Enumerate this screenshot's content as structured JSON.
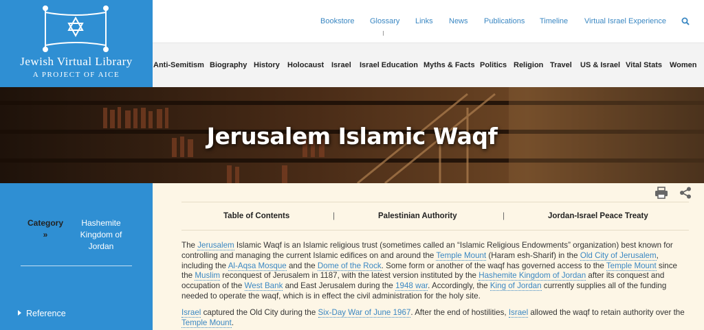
{
  "logo": {
    "line1": "Jewish Virtual Library",
    "line2": "A PROJECT OF AICE"
  },
  "topnav": [
    "Bookstore",
    "Glossary",
    "Links",
    "News",
    "Publications",
    "Timeline",
    "Virtual Israel Experience"
  ],
  "catnav": [
    "Anti-Semitism",
    "Biography",
    "History",
    "Holocaust",
    "Israel",
    "Israel Education",
    "Myths & Facts",
    "Politics",
    "Religion",
    "Travel",
    "US & Israel",
    "Vital Stats",
    "Women"
  ],
  "hero": {
    "title": "Jerusalem Islamic Waqf"
  },
  "sidebar": {
    "category_label": "Category »",
    "category_value": "Hashemite Kingdom of Jordan",
    "reference": "Reference"
  },
  "toc": {
    "items": [
      "Table of Contents",
      "Palestinian Authority",
      "Jordan-Israel Peace Treaty"
    ],
    "separator": "|"
  },
  "paragraphs": [
    [
      {
        "t": "The "
      },
      {
        "t": "Jerusalem",
        "link": true
      },
      {
        "t": " Islamic Waqf is an Islamic religious trust (sometimes called an “Islamic Religious Endowments” organization) best known for controlling and managing the current Islamic edifices on and around the "
      },
      {
        "t": "Temple Mount",
        "link": true
      },
      {
        "t": " (Haram esh-Sharif) in the "
      },
      {
        "t": "Old City of Jerusalem",
        "link": true
      },
      {
        "t": ", including the "
      },
      {
        "t": "Al-Aqsa Mosque",
        "link": true
      },
      {
        "t": " and the "
      },
      {
        "t": "Dome of the Rock",
        "link": true
      },
      {
        "t": ". Some form or another of the waqf has governed access to the "
      },
      {
        "t": "Temple Mount",
        "link": true
      },
      {
        "t": " since the "
      },
      {
        "t": "Muslim",
        "link": true
      },
      {
        "t": " reconquest of Jerusalem in 1187, with the latest version instituted by the "
      },
      {
        "t": "Hashemite Kingdom of Jordan",
        "link": true
      },
      {
        "t": " after its conquest and occupation of the "
      },
      {
        "t": "West Bank",
        "link": true
      },
      {
        "t": " and East Jerusalem during the "
      },
      {
        "t": "1948 war",
        "link": true
      },
      {
        "t": ". Accordingly, the "
      },
      {
        "t": "King of Jordan",
        "link": true
      },
      {
        "t": " currently supplies all of the funding needed to operate the waqf, which is in effect the civil administration for the holy site."
      }
    ],
    [
      {
        "t": "Israel",
        "link": true
      },
      {
        "t": " captured the Old City during the "
      },
      {
        "t": "Six-Day War of June 1967",
        "link": true
      },
      {
        "t": ". After the end of hostilities, "
      },
      {
        "t": "Israel",
        "link": true
      },
      {
        "t": " allowed the waqf to retain authority over the "
      },
      {
        "t": "Temple Mount",
        "link": true
      },
      {
        "t": "."
      }
    ]
  ],
  "colors": {
    "brand_blue": "#2f8fd3",
    "link_blue": "#3a87c2",
    "content_bg": "#fdf6e6"
  }
}
